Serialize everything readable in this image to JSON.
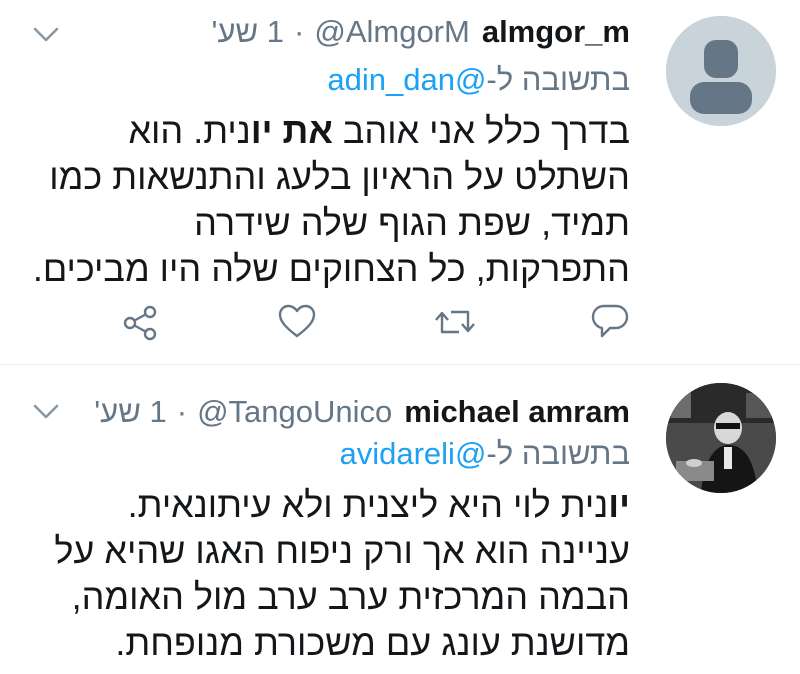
{
  "tweets": [
    {
      "display_name": "almgor_m",
      "handle": "@AlmgorM",
      "separator": "·",
      "time": "1 שע'",
      "reply_prefix": "בתשובה ל-",
      "reply_to": "@adin_dan",
      "text_parts": {
        "p1": "בדרך כלל אני אוהב ",
        "bold1": "את יו",
        "p2": "נית. הוא השתלט על הראיון בלעג והתנשאות כמו תמיד, שפת הגוף שלה שידרה התפרקות, כל הצחוקים שלה היו מביכים."
      },
      "avatar_icon": "default-avatar-icon"
    },
    {
      "display_name": "michael amram",
      "handle": "@TangoUnico",
      "separator": "·",
      "time": "1 שע'",
      "reply_prefix": "בתשובה ל-",
      "reply_to": "@avidareli",
      "text_parts": {
        "bold1": "יו",
        "p1": "נית לוי היא ליצנית ולא עיתונאית. עניינה הוא אך ורק ניפוח האגו שהיא על הבמה המרכזית ערב ערב מול האומה, מדושנת עונג עם משכורת מנופחת."
      },
      "avatar_icon": "photo-avatar"
    }
  ],
  "actions": [
    "reply-icon",
    "retweet-icon",
    "like-icon",
    "share-icon"
  ],
  "colors": {
    "link": "#1da1f2",
    "muted": "#657786",
    "text": "#14171a",
    "divider": "#e6ecf0"
  }
}
